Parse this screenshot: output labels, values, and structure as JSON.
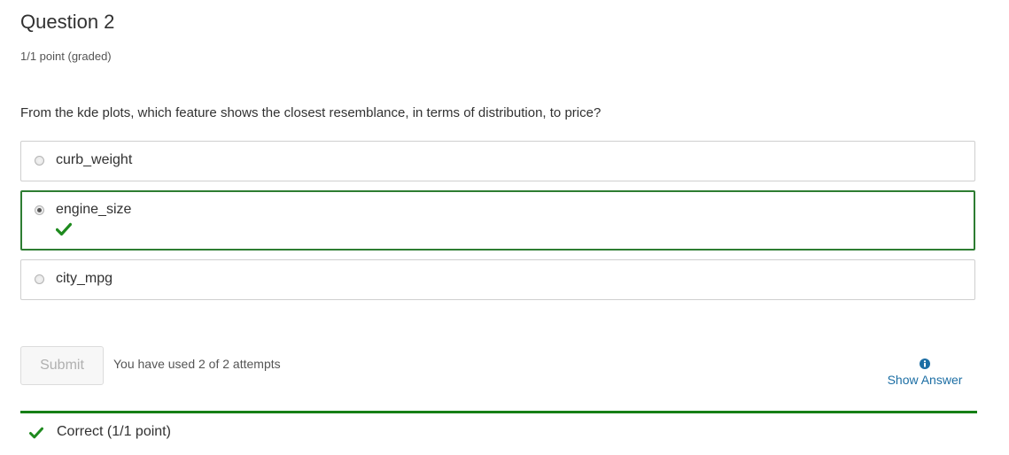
{
  "question": {
    "title": "Question 2",
    "points": "1/1 point (graded)",
    "text": "From the kde plots, which feature shows the closest resemblance, in terms of distribution, to price?"
  },
  "choices": [
    {
      "label": "curb_weight",
      "selected": false,
      "correct": false
    },
    {
      "label": "engine_size",
      "selected": true,
      "correct": true
    },
    {
      "label": "city_mpg",
      "selected": false,
      "correct": false
    }
  ],
  "actions": {
    "submit_label": "Submit",
    "attempts_text": "You have used 2 of 2 attempts",
    "show_answer_label": "Show Answer",
    "show_answer_icon": "info-circle-icon"
  },
  "feedback": {
    "text": "Correct (1/1 point)",
    "icon": "check-icon"
  },
  "colors": {
    "correct_green": "#2e7d32",
    "divider_green": "#157f15",
    "link_blue": "#1c6ea4"
  }
}
